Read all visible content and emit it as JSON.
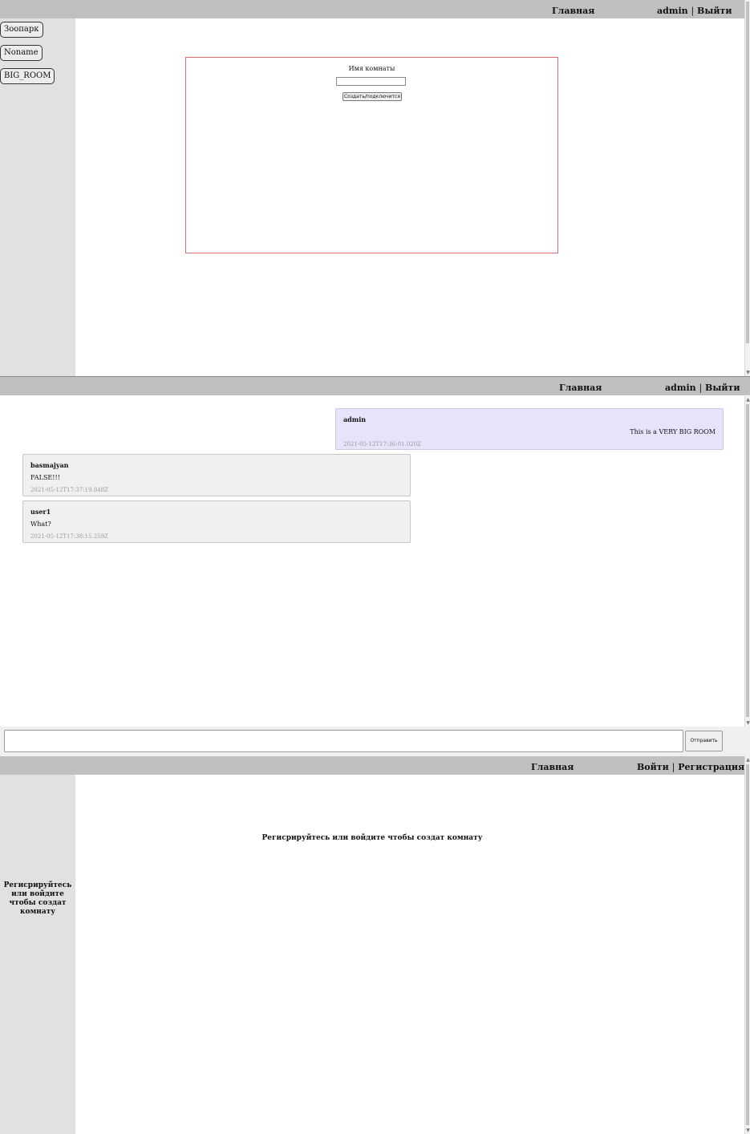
{
  "screen1": {
    "header": {
      "home_link": "Главная",
      "user": "admin",
      "separator": "|",
      "logout_link": "Выйти"
    },
    "sidebar": {
      "rooms": [
        {
          "label": "Зоопарк"
        },
        {
          "label": "Noname"
        },
        {
          "label": "BIG_ROOM"
        }
      ]
    },
    "create_room": {
      "label": "Имя комнаты",
      "input_value": "",
      "button_label": "Создать/подключится"
    }
  },
  "screen2": {
    "header": {
      "home_link": "Главная",
      "user": "admin",
      "separator": "|",
      "logout_link": "Выйти"
    },
    "messages": [
      {
        "author": "admin",
        "text": "This is a VERY BIG ROOM",
        "time": "2021-05-12T17:36:01.020Z",
        "own": true
      },
      {
        "author": "basmajyan",
        "text": "FALSE!!!",
        "time": "2021-05-12T17:37:19.848Z",
        "own": false
      },
      {
        "author": "user1",
        "text": "What?",
        "time": "2021-05-12T17:38:15.259Z",
        "own": false
      }
    ],
    "composer": {
      "input_value": "",
      "send_label": "Отправить"
    }
  },
  "screen3": {
    "header": {
      "home_link": "Главная",
      "login_link": "Войти",
      "separator": "|",
      "register_link": "Регистрация"
    },
    "main_message": "Регисрируйтесь или войдите чтобы создат комнату",
    "sidebar_message": "Регисрируйтесь или войдите чтобы создат комнату"
  }
}
